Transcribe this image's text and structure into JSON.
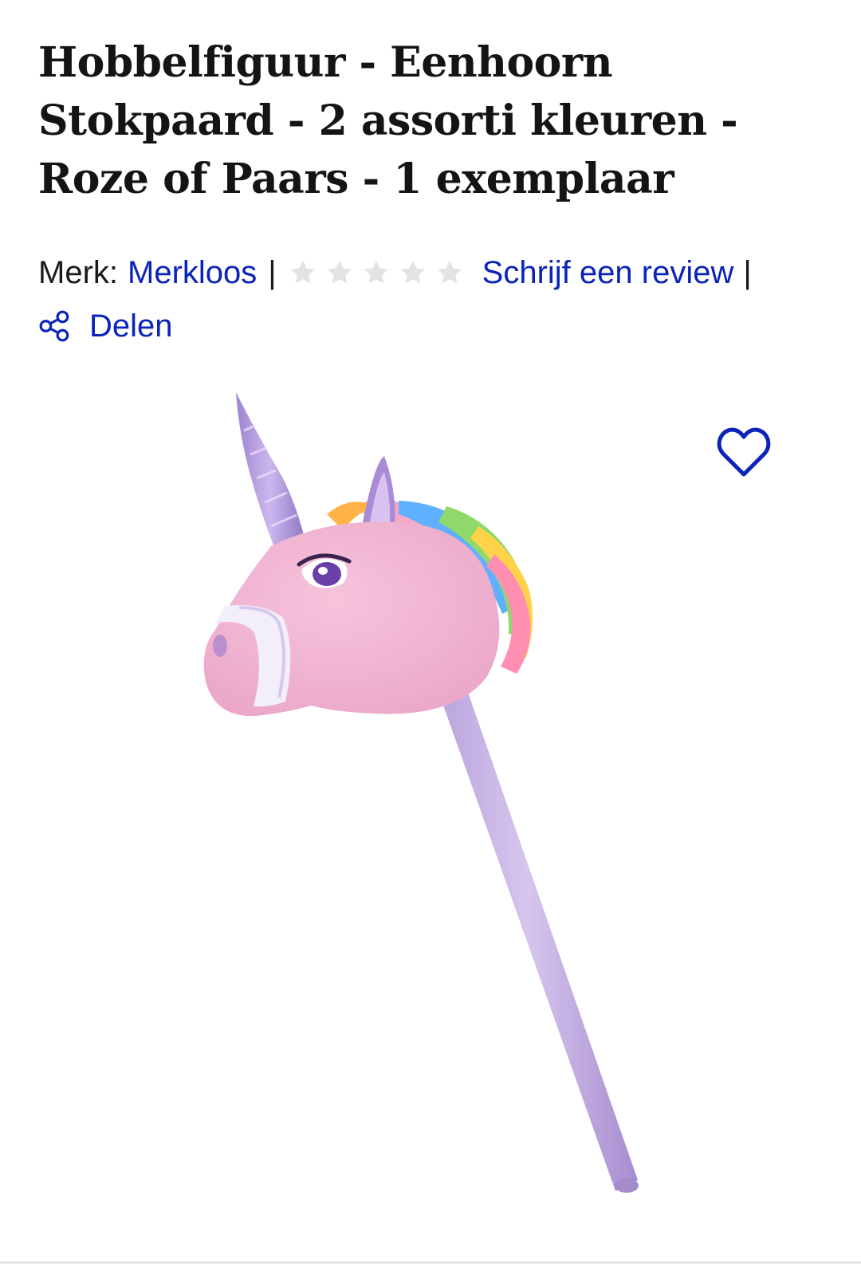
{
  "product": {
    "title": "Hobbelfiguur - Eenhoorn Stokpaard - 2 assorti kleuren - Roze of Paars - 1 exemplaar",
    "brand_label": "Merk:",
    "brand_name": "Merkloos",
    "separator": "|",
    "rating": {
      "stars_filled": 0,
      "stars_total": 5
    },
    "review_link": "Schrijf een review",
    "share_label": "Delen",
    "image_icon": "unicorn-hobby-horse"
  },
  "colors": {
    "link": "#0b23b8",
    "title": "#141414",
    "star_empty": "#e3e3e3"
  },
  "icons": {
    "share": "share-icon",
    "favorite": "heart-icon",
    "star": "star-icon"
  }
}
